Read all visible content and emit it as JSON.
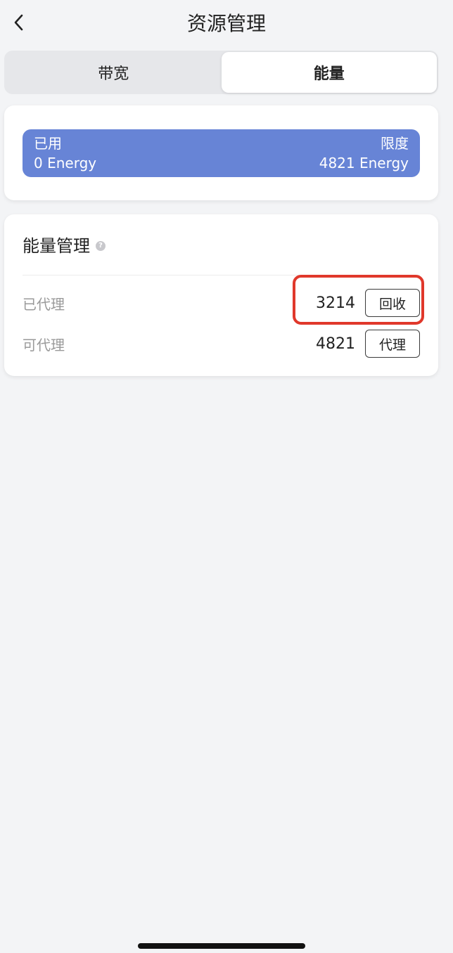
{
  "header": {
    "title": "资源管理",
    "back_icon": "chevron-left-icon"
  },
  "tabs": [
    {
      "label": "带宽",
      "active": false
    },
    {
      "label": "能量",
      "active": true
    }
  ],
  "usage": {
    "used_label": "已用",
    "limit_label": "限度",
    "used_value": "0 Energy",
    "limit_value": "4821 Energy",
    "bar_color": "#6784d6"
  },
  "manage": {
    "title": "能量管理",
    "help_icon": "question-circle-icon",
    "rows": [
      {
        "label": "已代理",
        "value": "3214",
        "button": "回收"
      },
      {
        "label": "可代理",
        "value": "4821",
        "button": "代理"
      }
    ]
  },
  "colors": {
    "highlight": "#e0382b",
    "background": "#f3f4f6"
  }
}
